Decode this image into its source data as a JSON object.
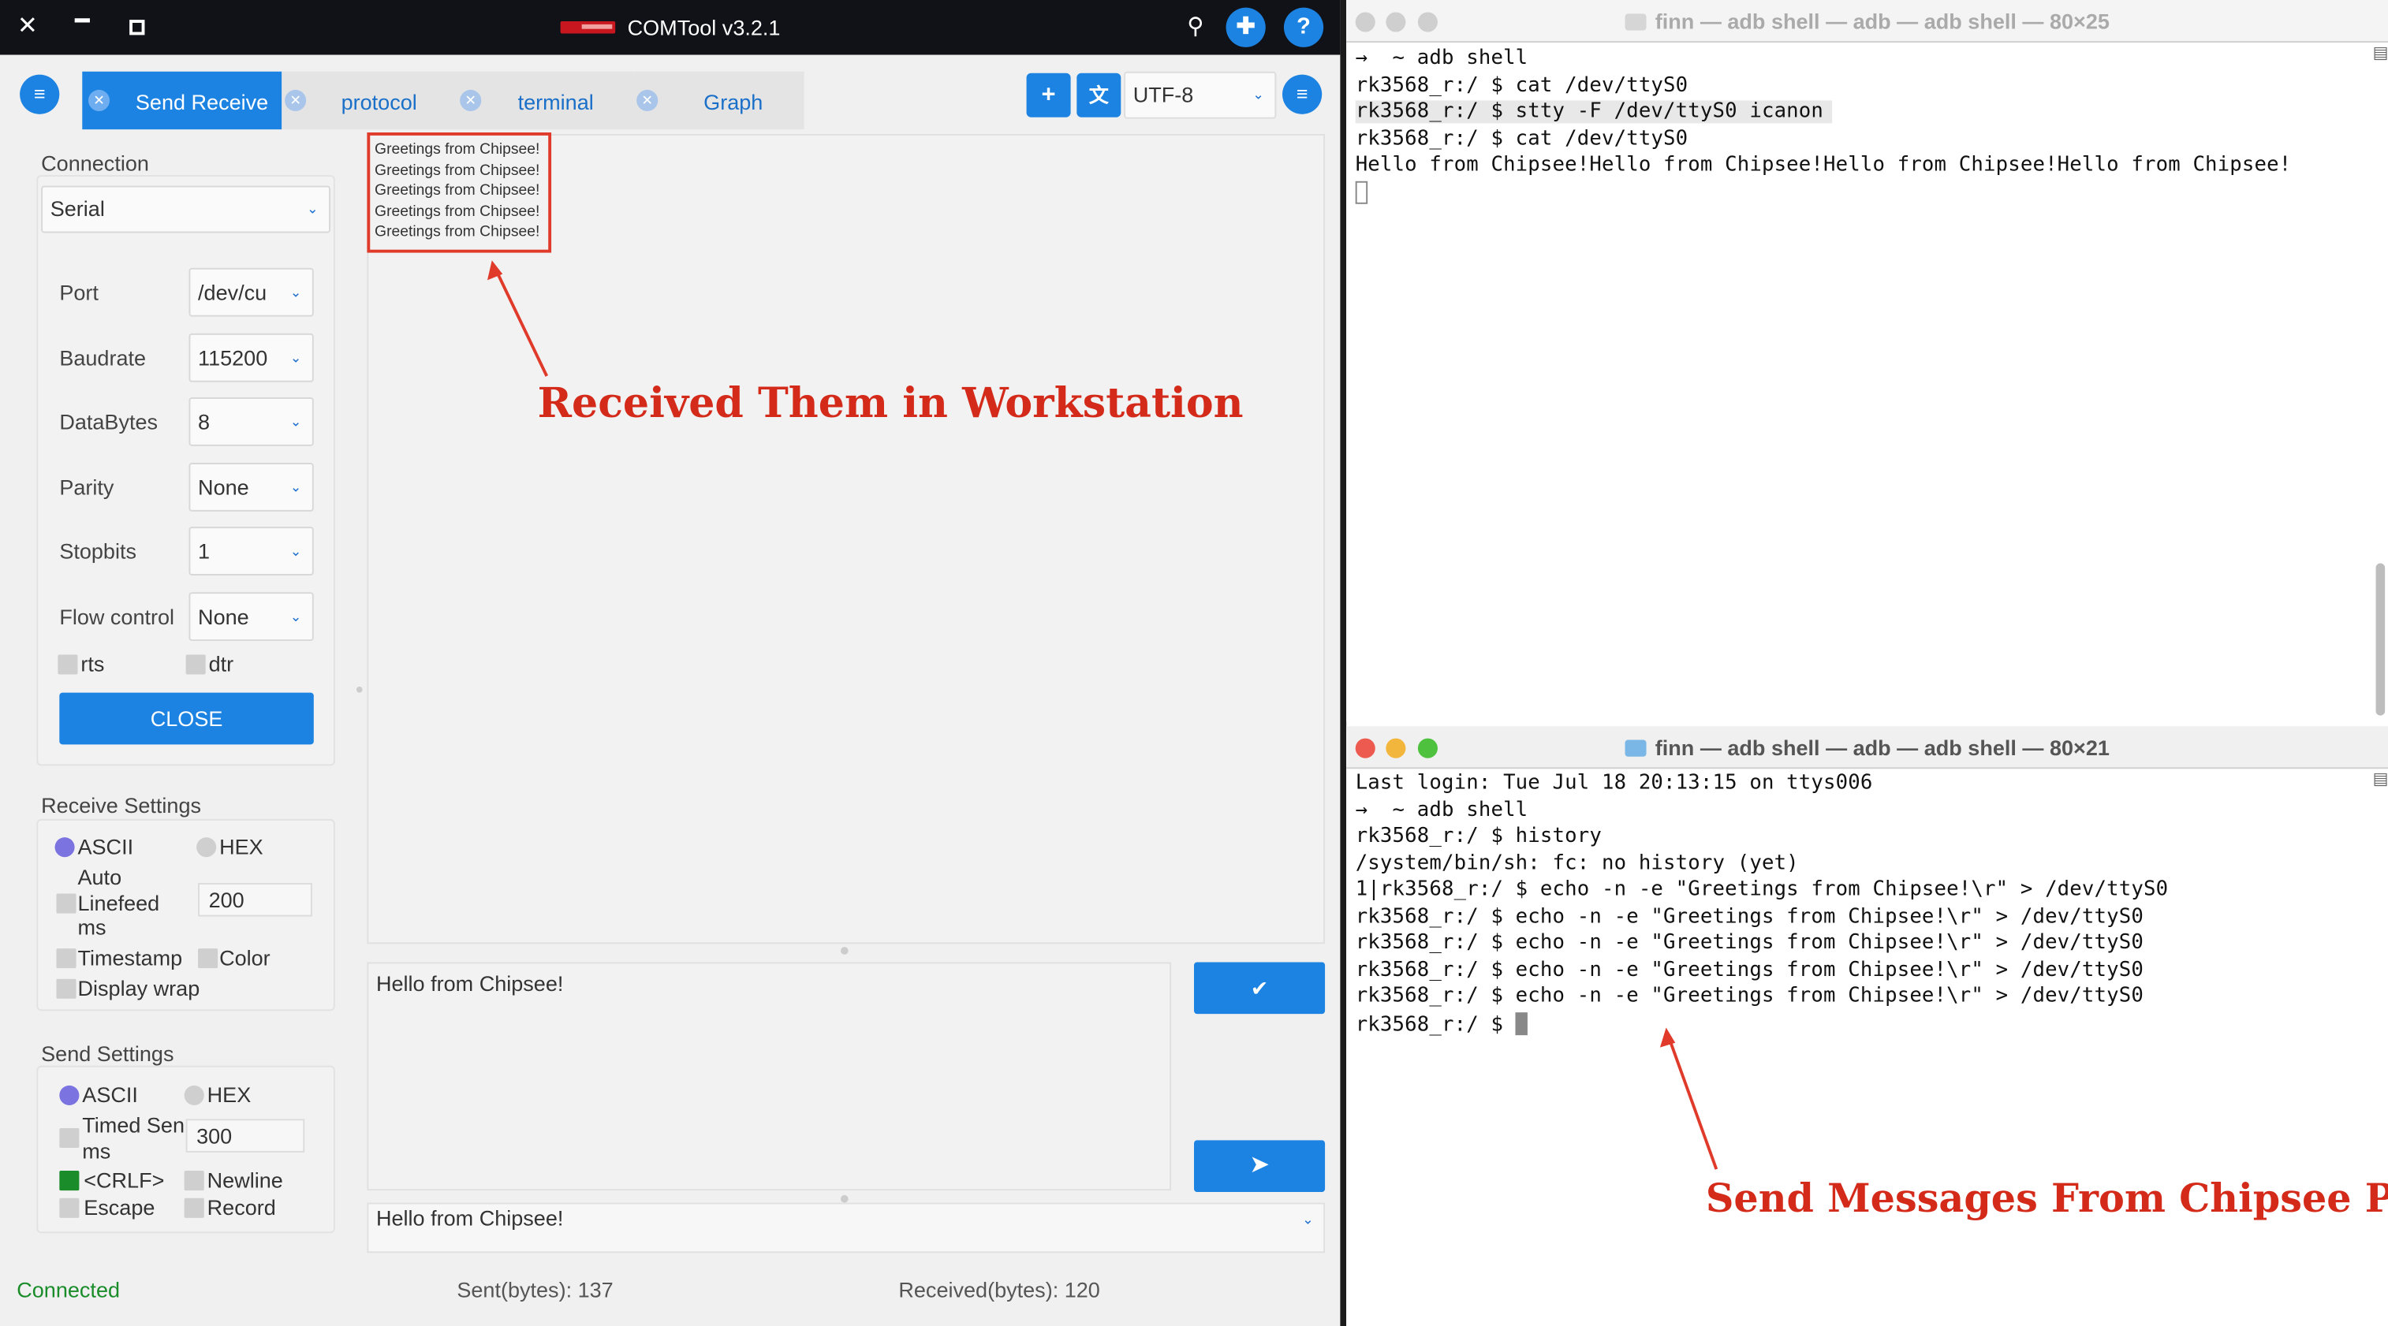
{
  "app": {
    "title": "COMTool v3.2.1",
    "tabs": [
      {
        "label": "Send Receive",
        "active": true
      },
      {
        "label": "protocol",
        "active": false
      },
      {
        "label": "terminal",
        "active": false
      },
      {
        "label": "Graph",
        "active": false
      }
    ],
    "encoding": "UTF-8",
    "connection": {
      "title": "Connection",
      "type": "Serial",
      "fields": [
        {
          "label": "Port",
          "value": "/dev/cu"
        },
        {
          "label": "Baudrate",
          "value": "115200"
        },
        {
          "label": "DataBytes",
          "value": "8"
        },
        {
          "label": "Parity",
          "value": "None"
        },
        {
          "label": "Stopbits",
          "value": "1"
        },
        {
          "label": "Flow control",
          "value": "None"
        }
      ],
      "rts": "rts",
      "dtr": "dtr",
      "close_label": "CLOSE"
    },
    "receive_settings": {
      "title": "Receive Settings",
      "ascii": "ASCII",
      "hex": "HEX",
      "auto_linefeed": [
        "Auto",
        "Linefeed",
        "ms"
      ],
      "auto_linefeed_value": "200",
      "timestamp": "Timestamp",
      "color": "Color",
      "display_wrap": "Display wrap"
    },
    "send_settings": {
      "title": "Send Settings",
      "ascii": "ASCII",
      "hex": "HEX",
      "timed_send": [
        "Timed Sen",
        "ms"
      ],
      "timed_send_value": "300",
      "crlf": "<CRLF>",
      "newline": "Newline",
      "escape": "Escape",
      "record": "Record"
    },
    "received_lines": [
      "Greetings from Chipsee!",
      "Greetings from Chipsee!",
      "Greetings from Chipsee!",
      "Greetings from Chipsee!",
      "Greetings from Chipsee!"
    ],
    "send_text": "Hello from Chipsee!",
    "history_value": "Hello from Chipsee!",
    "status": {
      "connected": "Connected",
      "sent": "Sent(bytes): 137",
      "received": "Received(bytes): 120"
    }
  },
  "annotations": {
    "workstation": "Received Them in Workstation",
    "chipsee": "Send Messages From Chipsee PC"
  },
  "terminal_top": {
    "title": "finn — adb shell — adb — adb shell — 80×25",
    "lines": [
      "→  ~ adb shell",
      "rk3568_r:/ $ cat /dev/ttyS0",
      "rk3568_r:/ $ stty -F /dev/ttyS0 icanon",
      "rk3568_r:/ $ cat /dev/ttyS0",
      "Hello from Chipsee!Hello from Chipsee!Hello from Chipsee!Hello from Chipsee!"
    ]
  },
  "terminal_bottom": {
    "title": "finn — adb shell — adb — adb shell — 80×21",
    "lines": [
      "Last login: Tue Jul 18 20:13:15 on ttys006",
      "→  ~ adb shell",
      "rk3568_r:/ $ history",
      "/system/bin/sh: fc: no history (yet)",
      "1|rk3568_r:/ $ echo -n -e \"Greetings from Chipsee!\\r\" > /dev/ttyS0",
      "rk3568_r:/ $ echo -n -e \"Greetings from Chipsee!\\r\" > /dev/ttyS0",
      "rk3568_r:/ $ echo -n -e \"Greetings from Chipsee!\\r\" > /dev/ttyS0",
      "rk3568_r:/ $ echo -n -e \"Greetings from Chipsee!\\r\" > /dev/ttyS0",
      "rk3568_r:/ $ echo -n -e \"Greetings from Chipsee!\\r\" > /dev/ttyS0",
      "rk3568_r:/ $ "
    ]
  }
}
